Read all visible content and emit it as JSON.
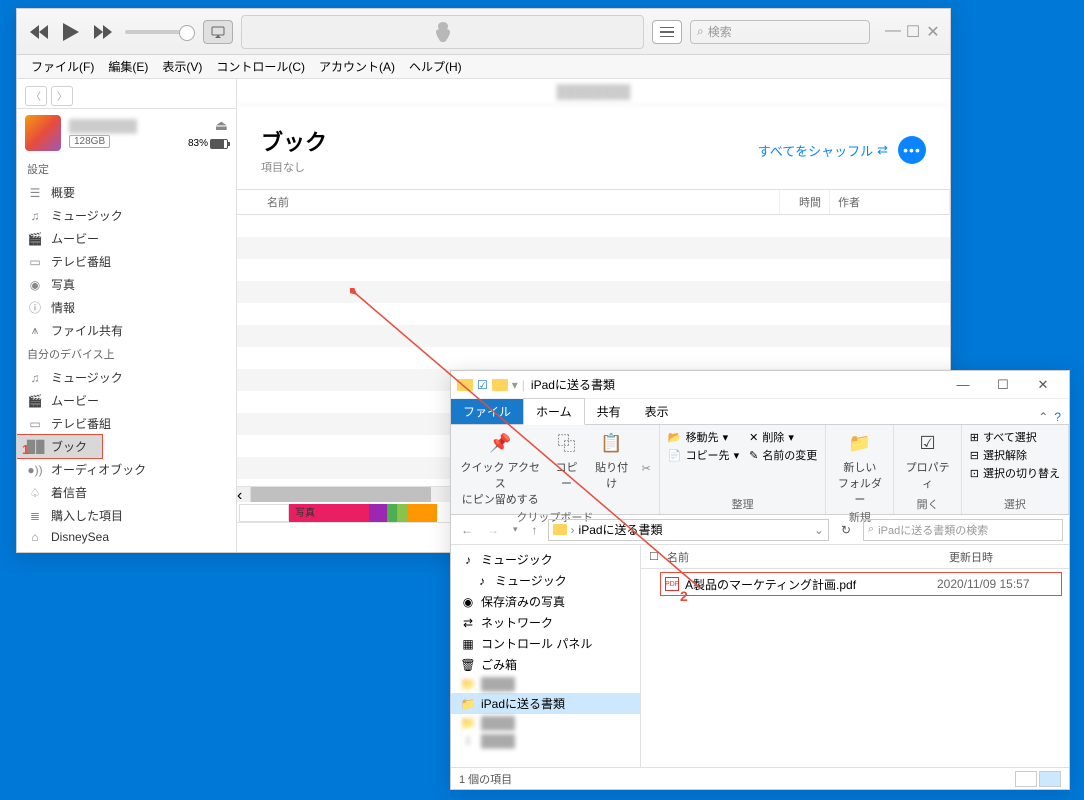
{
  "itunes": {
    "search_placeholder": "検索",
    "menu": [
      "ファイル(F)",
      "編集(E)",
      "表示(V)",
      "コントロール(C)",
      "アカウント(A)",
      "ヘルプ(H)"
    ],
    "device": {
      "capacity": "128GB",
      "battery": "83%"
    },
    "sidebar": {
      "section_settings": "設定",
      "section_device": "自分のデバイス上",
      "settings_items": [
        {
          "icon": "☰",
          "label": "概要"
        },
        {
          "icon": "♫",
          "label": "ミュージック"
        },
        {
          "icon": "🎬",
          "label": "ムービー"
        },
        {
          "icon": "▭",
          "label": "テレビ番組"
        },
        {
          "icon": "◉",
          "label": "写真"
        },
        {
          "icon": "ⓘ",
          "label": "情報"
        },
        {
          "icon": "⩚",
          "label": "ファイル共有"
        }
      ],
      "device_items": [
        {
          "icon": "♫",
          "label": "ミュージック"
        },
        {
          "icon": "🎬",
          "label": "ムービー"
        },
        {
          "icon": "▭",
          "label": "テレビ番組"
        },
        {
          "icon": "▉▉",
          "label": "ブック",
          "selected": true,
          "marked": true
        },
        {
          "icon": "●))",
          "label": "オーディオブック"
        },
        {
          "icon": "♤",
          "label": "着信音"
        },
        {
          "icon": "≣",
          "label": "購入した項目"
        },
        {
          "icon": "⌂",
          "label": "DisneySea"
        }
      ]
    },
    "page": {
      "title": "ブック",
      "subtitle": "項目なし",
      "shuffle": "すべてをシャッフル"
    },
    "columns": {
      "name": "名前",
      "time": "時間",
      "author": "作者"
    },
    "storage_label": "写真"
  },
  "explorer": {
    "title": "iPadに送る書類",
    "tabs": {
      "file": "ファイル",
      "home": "ホーム",
      "share": "共有",
      "view": "表示"
    },
    "ribbon": {
      "pin": "クイック アクセス\nにピン留めする",
      "copy": "コピー",
      "paste": "貼り付け",
      "group_clip": "クリップボード",
      "move_to": "移動先",
      "copy_to": "コピー先",
      "delete": "削除",
      "rename": "名前の変更",
      "group_org": "整理",
      "new_folder": "新しい\nフォルダー",
      "group_new": "新規",
      "properties": "プロパティ",
      "group_open": "開く",
      "select_all": "すべて選択",
      "select_none": "選択解除",
      "select_invert": "選択の切り替え",
      "group_select": "選択"
    },
    "breadcrumb": "iPadに送る書類",
    "search_placeholder": "iPadに送る書類の検索",
    "tree": [
      {
        "icon": "♪",
        "label": "ミュージック"
      },
      {
        "icon": "♪",
        "label": "ミュージック",
        "sub": true
      },
      {
        "icon": "◉",
        "label": "保存済みの写真"
      },
      {
        "icon": "⇄",
        "label": "ネットワーク"
      },
      {
        "icon": "▦",
        "label": "コントロール パネル"
      },
      {
        "icon": "🗑",
        "label": "ごみ箱"
      },
      {
        "icon": "📁",
        "label": "",
        "blur": true
      },
      {
        "icon": "📁",
        "label": "iPadに送る書類",
        "selected": true
      },
      {
        "icon": "📁",
        "label": "",
        "blur": true
      },
      {
        "icon": "⇩",
        "label": "",
        "blur": true
      }
    ],
    "list": {
      "col_name": "名前",
      "col_date": "更新日時",
      "file_name": "A製品のマーケティング計画.pdf",
      "file_date": "2020/11/09 15:57"
    },
    "status": "1 個の項目"
  },
  "markers": {
    "one": "1",
    "two": "2"
  }
}
